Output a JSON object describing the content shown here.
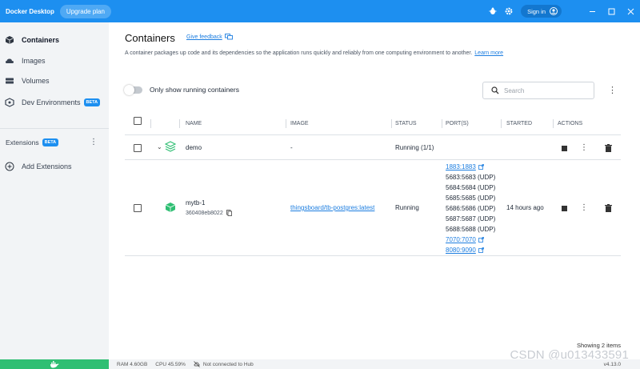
{
  "titlebar": {
    "app_title": "Docker Desktop",
    "upgrade_label": "Upgrade plan",
    "signin_label": "Sign in"
  },
  "sidebar": {
    "items": [
      {
        "label": "Containers",
        "icon": "containers-icon",
        "active": true
      },
      {
        "label": "Images",
        "icon": "images-icon"
      },
      {
        "label": "Volumes",
        "icon": "volumes-icon"
      },
      {
        "label": "Dev Environments",
        "icon": "dev-environments-icon",
        "badge": "BETA"
      }
    ],
    "extensions_label": "Extensions",
    "extensions_badge": "BETA",
    "add_extensions_label": "Add Extensions"
  },
  "main": {
    "title": "Containers",
    "feedback_label": "Give feedback",
    "description": "A container packages up code and its dependencies so the application runs quickly and reliably from one computing environment to another.",
    "learn_more": "Learn more",
    "toggle_label": "Only show running containers",
    "search_placeholder": "Search",
    "columns": [
      "NAME",
      "IMAGE",
      "STATUS",
      "PORT(S)",
      "STARTED",
      "ACTIONS"
    ],
    "rows": [
      {
        "name": "demo",
        "image": "-",
        "status": "Running (1/1)"
      },
      {
        "name": "mytb-1",
        "id": "360408eb8022",
        "image": "thingsboard/tb-postgres:latest",
        "status": "Running",
        "ports": [
          "1883:1883",
          "5683:5683 (UDP)",
          "5684:5684 (UDP)",
          "5685:5685 (UDP)",
          "5686:5686 (UDP)",
          "5687:5687 (UDP)",
          "5688:5688 (UDP)",
          "7070:7070",
          "8080:9090"
        ],
        "started": "14 hours ago"
      }
    ],
    "showing": "Showing 2 items"
  },
  "footer": {
    "ram": "RAM 4.60GB",
    "cpu": "CPU 45.59%",
    "hub_status": "Not connected to Hub",
    "version": "v4.13.0"
  },
  "watermark": "CSDN @u013433591",
  "colors": {
    "titlebar": "#1d8ff0",
    "accent": "#1d7ee0",
    "running_icon": "#2fbf73",
    "sidebar_bg": "#f2f4f6"
  }
}
